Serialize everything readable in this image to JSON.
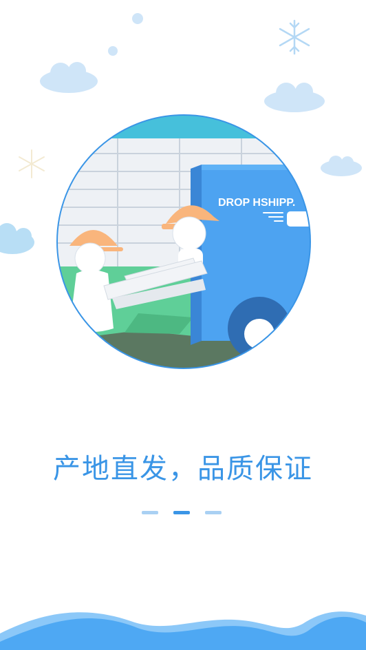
{
  "splash": {
    "title": "产地直发，品质保证",
    "truck_label": "DROP HSHIPP.",
    "colors": {
      "accent": "#3a95e6",
      "truck_blue": "#4da3f1",
      "sky_cloud": "#cfe5f8",
      "ground_green": "#5fcf98",
      "wave_blue": "#59adf4"
    }
  },
  "pager": {
    "total": 3,
    "active_index": 1
  }
}
